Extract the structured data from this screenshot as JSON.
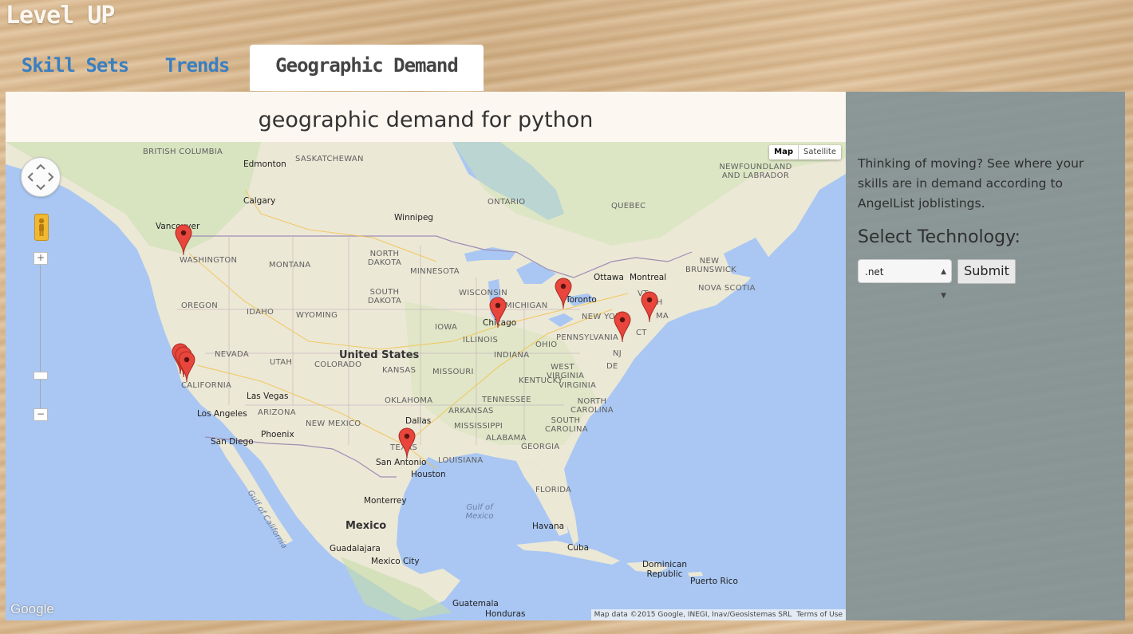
{
  "app": {
    "title": "Level UP"
  },
  "tabs": [
    {
      "label": "Skill Sets",
      "active": false
    },
    {
      "label": "Trends",
      "active": false
    },
    {
      "label": "Geographic Demand",
      "active": true
    }
  ],
  "main": {
    "title": "geographic demand for python"
  },
  "map": {
    "type_controls": {
      "map": "Map",
      "satellite": "Satellite",
      "selected": "Map"
    },
    "attribution": "Map data ©2015 Google, INEGI, Inav/Geosistemas SRL",
    "terms": "Terms of Use",
    "logo": "Google",
    "zoom_in": "+",
    "zoom_out": "−",
    "labels": {
      "british_columbia": "BRITISH COLUMBIA",
      "edmonton": "Edmonton",
      "saskatchewan": "SASKATCHEWAN",
      "calgary": "Calgary",
      "winnipeg": "Winnipeg",
      "ontario": "ONTARIO",
      "quebec": "QUEBEC",
      "newfoundland": "NEWFOUNDLAND AND LABRADOR",
      "vancouver": "Vancouver",
      "washington": "WASHINGTON",
      "montana": "MONTANA",
      "north_dakota": "NORTH DAKOTA",
      "minnesota": "MINNESOTA",
      "ottawa": "Ottawa",
      "montreal": "Montreal",
      "new_brunswick": "NEW BRUNSWICK",
      "nova_scotia": "NOVA SCOTIA",
      "oregon": "OREGON",
      "idaho": "IDAHO",
      "wyoming": "WYOMING",
      "south_dakota": "SOUTH DAKOTA",
      "wisconsin": "WISCONSIN",
      "michigan": "MICHIGAN",
      "toronto": "Toronto",
      "vt": "VT",
      "nh": "NH",
      "new_york": "NEW YORK",
      "ma": "MA",
      "ct": "CT",
      "chicago": "Chicago",
      "iowa": "IOWA",
      "nevada": "NEVADA",
      "utah": "UTAH",
      "united_states": "United States",
      "colorado": "COLORADO",
      "illinois": "ILLINOIS",
      "ohio": "OHIO",
      "pennsylvania": "PENNSYLVANIA",
      "nj": "NJ",
      "de": "DE",
      "kansas": "KANSAS",
      "missouri": "MISSOURI",
      "indiana": "INDIANA",
      "west_virginia": "WEST VIRGINIA",
      "virginia": "VIRGINIA",
      "california": "CALIFORNIA",
      "las_vegas": "Las Vegas",
      "kentucky": "KENTUCKY",
      "oklahoma": "OKLAHOMA",
      "tennessee": "TENNESSEE",
      "north_carolina": "NORTH CAROLINA",
      "los_angeles": "Los Angeles",
      "arizona": "ARIZONA",
      "new_mexico": "NEW MEXICO",
      "arkansas": "ARKANSAS",
      "south_carolina": "SOUTH CAROLINA",
      "san_diego": "San Diego",
      "phoenix": "Phoenix",
      "dallas": "Dallas",
      "mississippi": "MISSISSIPPI",
      "alabama": "ALABAMA",
      "georgia": "GEORGIA",
      "texas": "TEXAS",
      "louisiana": "LOUISIANA",
      "san_antonio": "San Antonio",
      "houston": "Houston",
      "gulf_of_california": "Gulf of California",
      "florida": "FLORIDA",
      "monterrey": "Monterrey",
      "gulf_of_mexico": "Gulf of Mexico",
      "mexico": "Mexico",
      "havana": "Havana",
      "cuba": "Cuba",
      "guadalajara": "Guadalajara",
      "mexico_city": "Mexico City",
      "dominican_republic": "Dominican Republic",
      "puerto_rico": "Puerto Rico",
      "guatemala": "Guatemala",
      "honduras": "Honduras"
    }
  },
  "sidebar": {
    "description": "Thinking of moving? See where your skills are in demand according to AngelList joblistings.",
    "select_label": "Select Technology:",
    "selected_technology": ".net",
    "submit_label": "Submit"
  },
  "colors": {
    "tab_link": "#3a7fc1",
    "marker": "#e8453c",
    "sidebar_bg": "#809296",
    "land": "#ece8d6",
    "water": "#a9c7f2"
  }
}
